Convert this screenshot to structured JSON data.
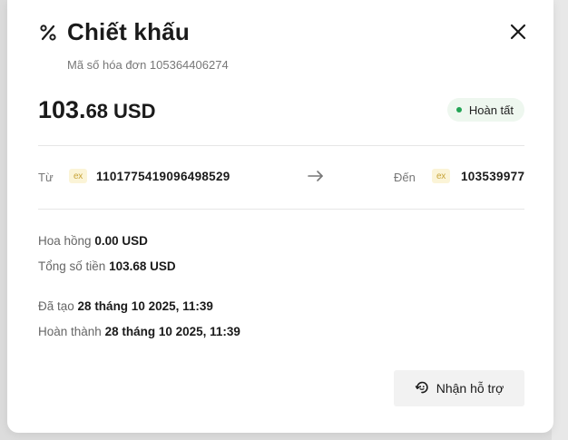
{
  "modal": {
    "title": "Chiết khấu",
    "title_icon": "percent-icon",
    "subtitle": "Mã số hóa đơn 105364406274",
    "close_icon": "close-icon"
  },
  "amount": {
    "integer": "103.",
    "decimal": "68",
    "currency": "USD"
  },
  "status": {
    "label": "Hoàn tất",
    "color": "#23a455"
  },
  "transfer": {
    "from_label": "Từ",
    "from_badge": "ex",
    "from_account": "1101775419096498529",
    "arrow_icon": "arrow-right-icon",
    "to_label": "Đến",
    "to_badge": "ex",
    "to_account": "103539977"
  },
  "details": {
    "commission_label": "Hoa hồng",
    "commission_value": "0.00 USD",
    "total_label": "Tổng số tiền",
    "total_value": "103.68 USD",
    "created_label": "Đã tạo",
    "created_value": "28 tháng 10 2025, 11:39",
    "completed_label": "Hoàn thành",
    "completed_value": "28 tháng 10 2025, 11:39"
  },
  "support": {
    "label": "Nhận hỗ trợ",
    "icon": "support-icon"
  }
}
